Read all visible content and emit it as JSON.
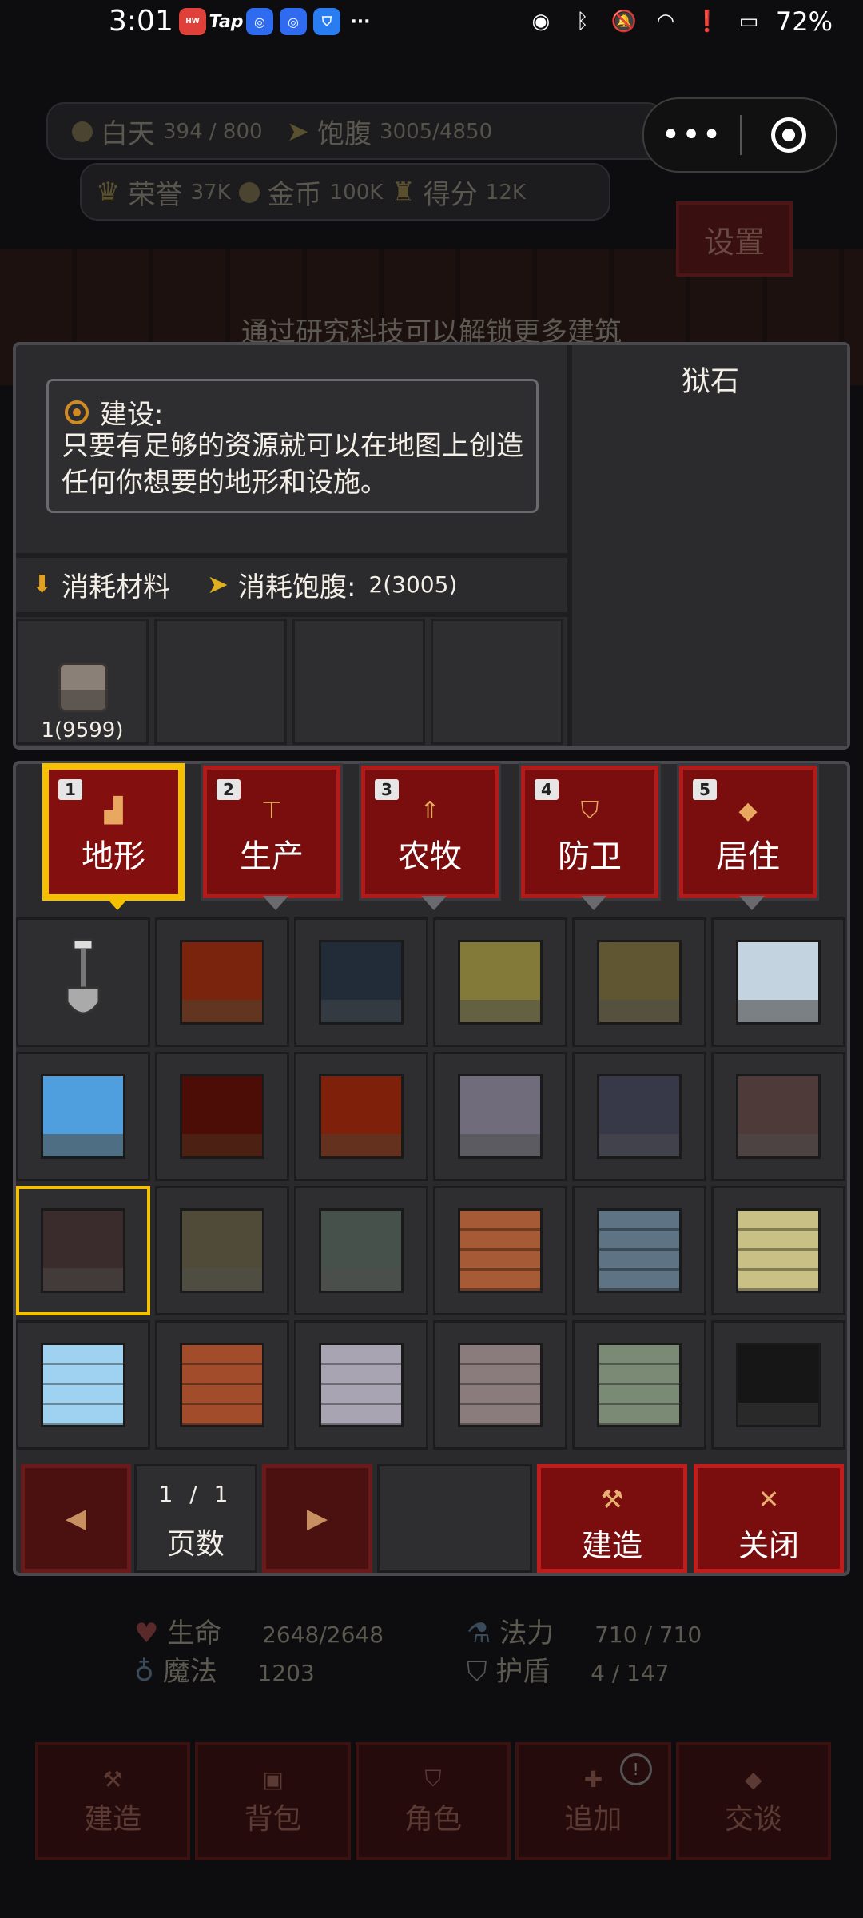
{
  "status_bar": {
    "time": "3:01",
    "apps": [
      "HUAWEI",
      "Tap",
      "",
      "",
      ""
    ],
    "more": "···",
    "battery": "72%",
    "icons": [
      "eye-icon",
      "bluetooth-icon",
      "mute-icon",
      "wifi-icon",
      "alert-icon",
      "battery-icon"
    ]
  },
  "hud": {
    "day_label": "白天",
    "day_value": "394 / 800",
    "satiety_label": "饱腹",
    "satiety_value": "3005/4850",
    "honor_label": "荣誉",
    "honor_value": "37K",
    "gold_label": "金币",
    "gold_value": "100K",
    "score_label": "得分",
    "score_value": "12K",
    "settings": "设置",
    "hint": "通过研究科技可以解锁更多建筑",
    "mini_more": "•••"
  },
  "build_info": {
    "title": "建设:",
    "description": "只要有足够的资源就可以在地图上创造任何你想要的地形和设施。",
    "cost_materials_label": "消耗材料",
    "cost_satiety_label": "消耗饱腹:",
    "cost_satiety_value": "2(3005)",
    "material_qty": "1(9599)",
    "preview_title": "狱石"
  },
  "tabs": [
    {
      "num": "1",
      "label": "地形",
      "icon": "terrain-icon",
      "glyph": "▟",
      "active": true
    },
    {
      "num": "2",
      "label": "生产",
      "icon": "anvil-icon",
      "glyph": "⊤",
      "active": false
    },
    {
      "num": "3",
      "label": "农牧",
      "icon": "tree-icon",
      "glyph": "⇑",
      "active": false
    },
    {
      "num": "4",
      "label": "防卫",
      "icon": "shield-icon",
      "glyph": "⛉",
      "active": false
    },
    {
      "num": "5",
      "label": "居住",
      "icon": "diamond-icon",
      "glyph": "◆",
      "active": false
    }
  ],
  "tiles": [
    {
      "name": "shovel-tool",
      "color": "#9a9a9a"
    },
    {
      "name": "dirt-tile",
      "color": "#b0603a"
    },
    {
      "name": "slate-tile",
      "color": "#5c6a78"
    },
    {
      "name": "sand-tile",
      "color": "#b7b07a"
    },
    {
      "name": "mossy-sand-tile",
      "color": "#9c9470"
    },
    {
      "name": "snow-tile",
      "color": "#dfe8ef"
    },
    {
      "name": "ice-tile",
      "color": "#8ec9ee"
    },
    {
      "name": "cracked-dirt-tile",
      "color": "#8a3a22"
    },
    {
      "name": "clay-tile",
      "color": "#b45a34"
    },
    {
      "name": "light-stone-tile",
      "color": "#a9a6b2"
    },
    {
      "name": "carved-stone-tile",
      "color": "#767888"
    },
    {
      "name": "rose-stone-tile",
      "color": "#8e7a7a"
    },
    {
      "name": "prison-stone-tile",
      "color": "#7a6a6a"
    },
    {
      "name": "ancient-stone-tile",
      "color": "#8f8a78"
    },
    {
      "name": "rune-stone-tile",
      "color": "#86908a"
    },
    {
      "name": "brown-brick-tile",
      "color": "#a65a36"
    },
    {
      "name": "blue-brick-tile",
      "color": "#5e7384"
    },
    {
      "name": "sand-brick-tile",
      "color": "#c8c084"
    },
    {
      "name": "ice-brick-tile",
      "color": "#9fd2f0"
    },
    {
      "name": "red-brick-tile",
      "color": "#a24c2c"
    },
    {
      "name": "grey-brick-tile",
      "color": "#a8a4b2"
    },
    {
      "name": "dusk-brick-tile",
      "color": "#8a7c7c"
    },
    {
      "name": "moss-brick-tile",
      "color": "#7b8a74"
    },
    {
      "name": "dark-furnace-tile",
      "color": "#4a4a4c"
    }
  ],
  "selected_tile_index": 12,
  "pagination": {
    "current": "1 / 1",
    "label": "页数",
    "prev": "◀",
    "next": "▶"
  },
  "actions": {
    "build": "建造",
    "close": "关闭",
    "build_icon": "⚒",
    "close_icon": "✕"
  },
  "player_stats": {
    "hp_label": "生命",
    "hp_value": "2648/2648",
    "mana_label": "法力",
    "mana_value": "710 / 710",
    "magic_label": "魔法",
    "magic_value": "1203",
    "shield_label": "护盾",
    "shield_value": "4 / 147"
  },
  "bottom_nav": [
    {
      "label": "建造",
      "icon": "hammer-icon",
      "glyph": "⚒"
    },
    {
      "label": "背包",
      "icon": "bag-icon",
      "glyph": "▣"
    },
    {
      "label": "角色",
      "icon": "shield-icon",
      "glyph": "⛉"
    },
    {
      "label": "追加",
      "icon": "plus-icon",
      "glyph": "✚",
      "badge": "!"
    },
    {
      "label": "交谈",
      "icon": "chat-icon",
      "glyph": "◆"
    }
  ]
}
